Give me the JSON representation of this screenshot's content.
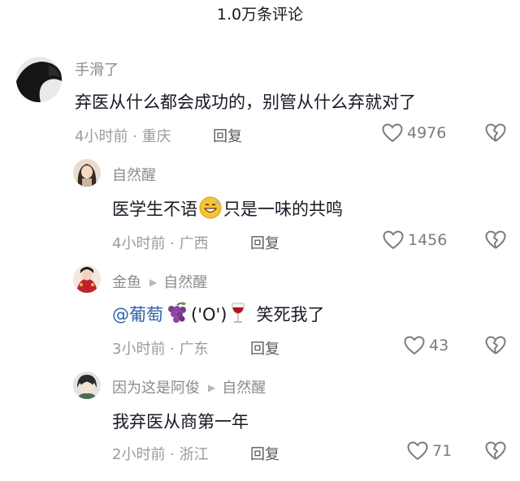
{
  "header": {
    "title": "1.0万条评论"
  },
  "comments": [
    {
      "username": "手滑了",
      "text": "弃医从什么都会成功的，别管从什么弃就对了",
      "time": "4小时前",
      "location": "重庆",
      "reply_label": "回复",
      "likes": "4976",
      "avatar_icon": "dark-silhouette-avatar"
    },
    {
      "username": "自然醒",
      "text_before": "医学生不语",
      "emoji": "grinning-sweat-emoji",
      "text_after": "只是一味的共鸣",
      "time": "4小时前",
      "location": "广西",
      "reply_label": "回复",
      "likes": "1456",
      "avatar_icon": "girl-avatar"
    },
    {
      "username": "金鱼",
      "reply_to": "自然醒",
      "mention": "@葡萄",
      "grape_emoji": "grape-emoji",
      "face": "('O')",
      "wine_emoji": "wine-glass-emoji",
      "text_after": "笑死我了",
      "time": "3小时前",
      "location": "广东",
      "reply_label": "回复",
      "likes": "43",
      "avatar_icon": "red-costume-avatar"
    },
    {
      "username": "因为这是阿俊",
      "reply_to": "自然醒",
      "text": "我弃医从商第一年",
      "time": "2小时前",
      "location": "浙江",
      "reply_label": "回复",
      "likes": "71",
      "avatar_icon": "anime-avatar"
    }
  ],
  "separator": " · ",
  "colors": {
    "mention": "#2f63a6",
    "meta": "#9a9ba0",
    "text": "#161823"
  }
}
